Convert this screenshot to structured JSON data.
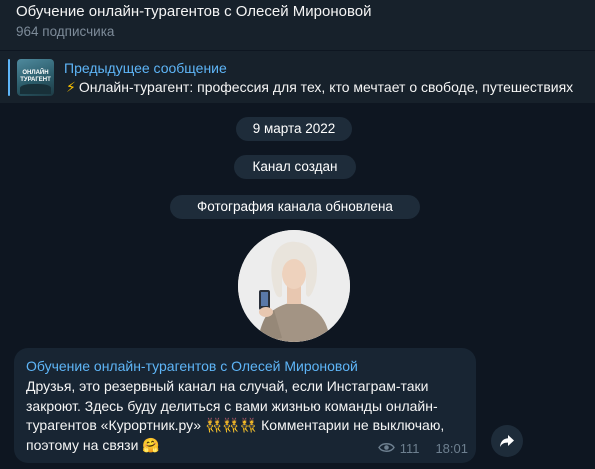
{
  "header": {
    "title": "Обучение онлайн-турагентов с Олесей Мироновой",
    "subscribers": "964 подписчика"
  },
  "pinned": {
    "thumb_line1": "ОНЛАЙН",
    "thumb_line2": "ТУРАГЕНТ",
    "label": "Предыдущее сообщение",
    "text": "Онлайн-турагент: профессия для тех, кто мечтает о свободе, путешествиях"
  },
  "service": {
    "date": "9 марта 2022",
    "created": "Канал создан",
    "photo_updated": "Фотография канала обновлена"
  },
  "message": {
    "author": "Обучение онлайн-турагентов с Олесей Мироновой",
    "text": "Друзья, это резервный канал на случай, если Инстаграм-таки закроют. Здесь буду делиться с вами жизнью команды онлайн-турагентов «Курортник.ру» 👯👯👯  Комментарии не выключаю, поэтому на связи 🤗",
    "views": "111",
    "time": "18:01"
  },
  "icons": {
    "bolt": "⚡",
    "eye": "eye-icon",
    "share": "share-icon"
  },
  "colors": {
    "background": "#0e1621",
    "header": "#17212b",
    "accent": "#5eb5f7",
    "bubble": "#182533"
  }
}
